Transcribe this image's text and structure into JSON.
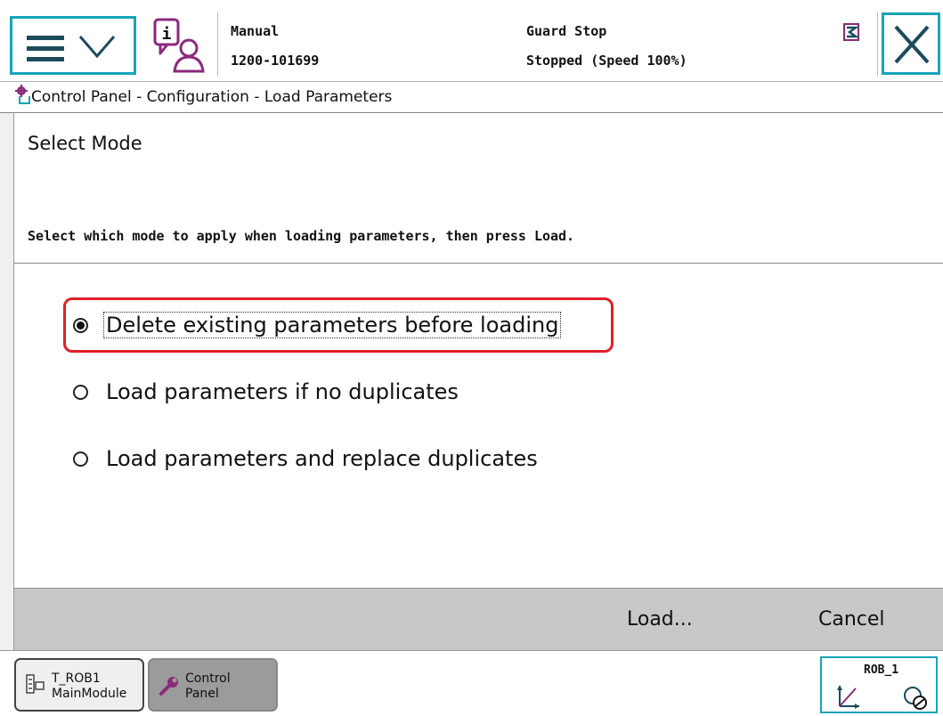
{
  "status": {
    "mode": "Manual",
    "controller_id": "1200-101699",
    "state": "Guard Stop",
    "run_state": "Stopped (Speed 100%)"
  },
  "icons": {
    "menu": "hamburger-menu-icon",
    "info": "info-person-icon",
    "status_indicator": "status-indicator-icon",
    "close": "close-x-icon",
    "control_panel": "control-panel-icon",
    "task": "program-module-icon",
    "wrench": "wrench-icon",
    "jog": "jog-coordinate-icon"
  },
  "breadcrumb": "Control Panel - Configuration - Load Parameters",
  "dialog": {
    "title": "Select Mode",
    "instruction": "Select which mode to apply when loading parameters, then press Load.",
    "options": [
      {
        "label": "Delete existing parameters before loading",
        "checked": true
      },
      {
        "label": "Load parameters if no duplicates",
        "checked": false
      },
      {
        "label": "Load parameters and replace duplicates",
        "checked": false
      }
    ]
  },
  "commands": {
    "load": "Load...",
    "cancel": "Cancel"
  },
  "taskbar": {
    "task1_line1": "T_ROB1",
    "task1_line2": "MainModule",
    "task2_line1": "Control",
    "task2_line2": "Panel",
    "robot": "ROB_1"
  },
  "colors": {
    "accent": "#16a5b8",
    "highlight": "#e01f26",
    "brand_purple": "#8a2a7b"
  }
}
